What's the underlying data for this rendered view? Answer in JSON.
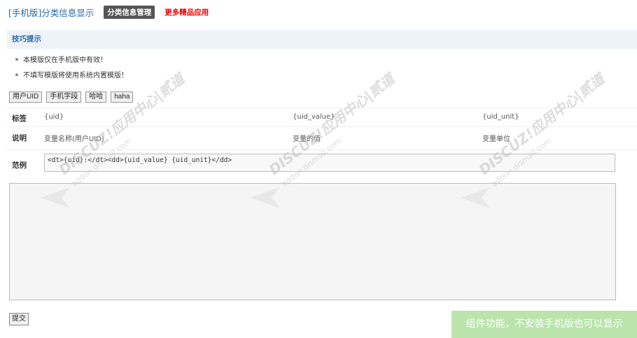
{
  "header": {
    "title": "[手机版]分类信息显示",
    "tag": "分类信息管理",
    "more_link": "更多精品应用"
  },
  "tips": {
    "heading": "技巧提示",
    "items": [
      "本模版仅在手机版中有效！",
      "不填写模版将使用系统内置模版！"
    ]
  },
  "tabs": [
    "用户UID",
    "手机字段",
    "哈哈",
    "haha"
  ],
  "variables": {
    "tag_label": "标签",
    "desc_label": "说明",
    "columns": [
      {
        "tag": "{uid}",
        "desc": "变量名称(用户UID)"
      },
      {
        "tag": "{uid_value}",
        "desc": "变量的值"
      },
      {
        "tag": "{uid_unit}",
        "desc": "变量单位"
      }
    ]
  },
  "example": {
    "label": "范例",
    "code": "<dt>{uid}:</dt><dd>{uid_value} {uid_unit}</dd>"
  },
  "template": {
    "value": ""
  },
  "submit_label": "提交",
  "watermark": {
    "brand": "DISCUZ!应用中心|贰道",
    "url": "addon.dismall.com"
  },
  "toast": "组件功能，不安装手机版也可以显示"
}
